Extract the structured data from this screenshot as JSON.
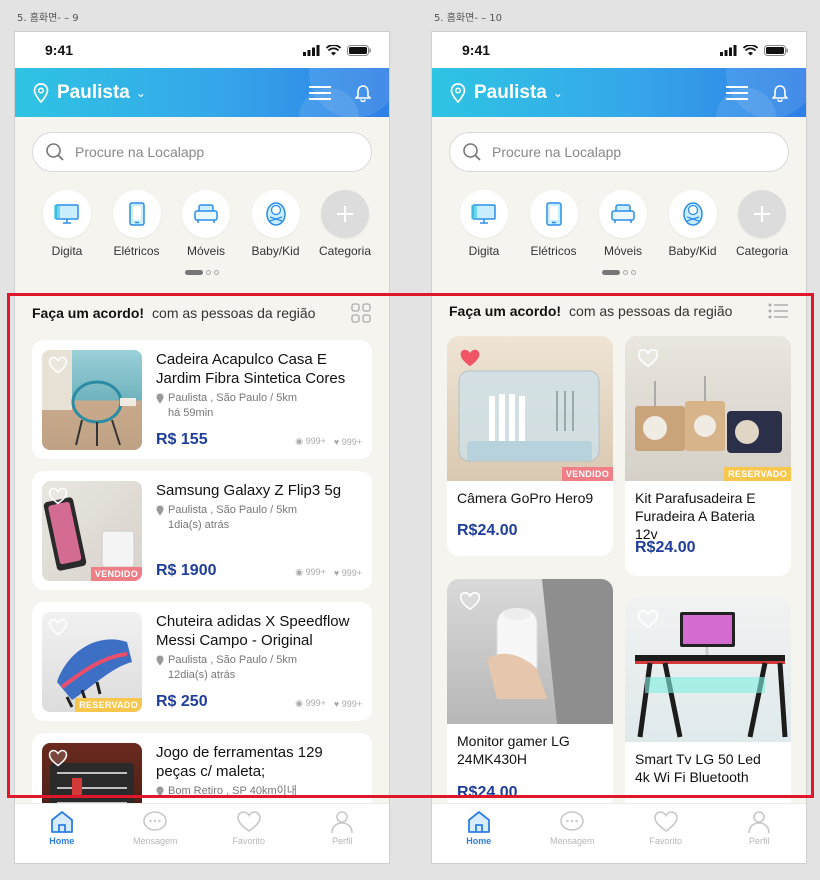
{
  "frames": [
    {
      "label": "5. 홈화면- – 9"
    },
    {
      "label": "5. 홈화면- – 10"
    }
  ],
  "status": {
    "time": "9:41"
  },
  "header": {
    "location": "Paulista"
  },
  "search": {
    "placeholder": "Procure na  Localapp"
  },
  "categories": [
    {
      "label": "Digita",
      "icon": "monitor-icon"
    },
    {
      "label": "Elétricos",
      "icon": "phone-icon"
    },
    {
      "label": "Móveis",
      "icon": "sofa-icon"
    },
    {
      "label": "Baby/Kid",
      "icon": "baby-icon"
    },
    {
      "label": "Categoria",
      "icon": "plus-icon"
    }
  ],
  "section": {
    "title": "Faça um acordo!",
    "subtitle": "com as pessoas da região"
  },
  "list_items": [
    {
      "title_line1": "Cadeira Acapulco Casa E",
      "title_line2": "Jardim Fibra Sintetica Cores",
      "location": "Paulista ,  São Paulo /  5km",
      "time": "há 59min",
      "price": "R$ 155",
      "views": "999+",
      "likes": "999+",
      "badge": ""
    },
    {
      "title_line1": "Samsung Galaxy Z Flip3 5g",
      "title_line2": "",
      "location": "Paulista ,  São Paulo /  5km",
      "time": "1dia(s) atrás",
      "price": "R$ 1900",
      "views": "999+",
      "likes": "999+",
      "badge": "VENDIDO"
    },
    {
      "title_line1": "Chuteira adidas X Speedflow",
      "title_line2": "Messi Campo - Original",
      "location": "Paulista ,  São Paulo /  5km",
      "time": "12dia(s) atrás",
      "price": "R$ 250",
      "views": "999+",
      "likes": "999+",
      "badge": "RESERVADO"
    },
    {
      "title_line1": "Jogo de ferramentas 129",
      "title_line2": "peças c/ maleta;",
      "location": "Bom Retiro , SP   40km이내",
      "time": "",
      "price": "",
      "views": "",
      "likes": "",
      "badge": ""
    }
  ],
  "grid_items": [
    {
      "title_line1": "Câmera GoPro Hero9",
      "title_line2": "",
      "title_line3": "",
      "price": "R$24.00",
      "badge": "VENDIDO",
      "liked": true
    },
    {
      "title_line1": "Kit Parafusadeira E",
      "title_line2": "Furadeira A Bateria",
      "title_line3": "12v",
      "price": "R$24.00",
      "badge": "RESERVADO",
      "liked": false
    },
    {
      "title_line1": "Monitor gamer LG",
      "title_line2": "24MK430H",
      "title_line3": "",
      "price": "R$24.00",
      "badge": "",
      "liked": false
    },
    {
      "title_line1": "Smart Tv LG 50 Led",
      "title_line2": "4k Wi Fi Bluetooth",
      "title_line3": "",
      "price": "",
      "badge": "",
      "liked": false
    }
  ],
  "tabs": [
    {
      "label": "Home",
      "icon": "home-icon",
      "active": true
    },
    {
      "label": "Mensagem",
      "icon": "chat-icon",
      "active": false
    },
    {
      "label": "Favorito",
      "icon": "heart-icon",
      "active": false
    },
    {
      "label": "Perfil",
      "icon": "user-icon",
      "active": false
    }
  ],
  "colors": {
    "header_start": "#2fc4e3",
    "header_end": "#2f7fe6",
    "price": "#1f3d9a",
    "sold_badge": "#ef7e86",
    "reserved_badge": "#f7c64c",
    "highlight_box": "#e0162b",
    "active_tab": "#2e7de3"
  }
}
